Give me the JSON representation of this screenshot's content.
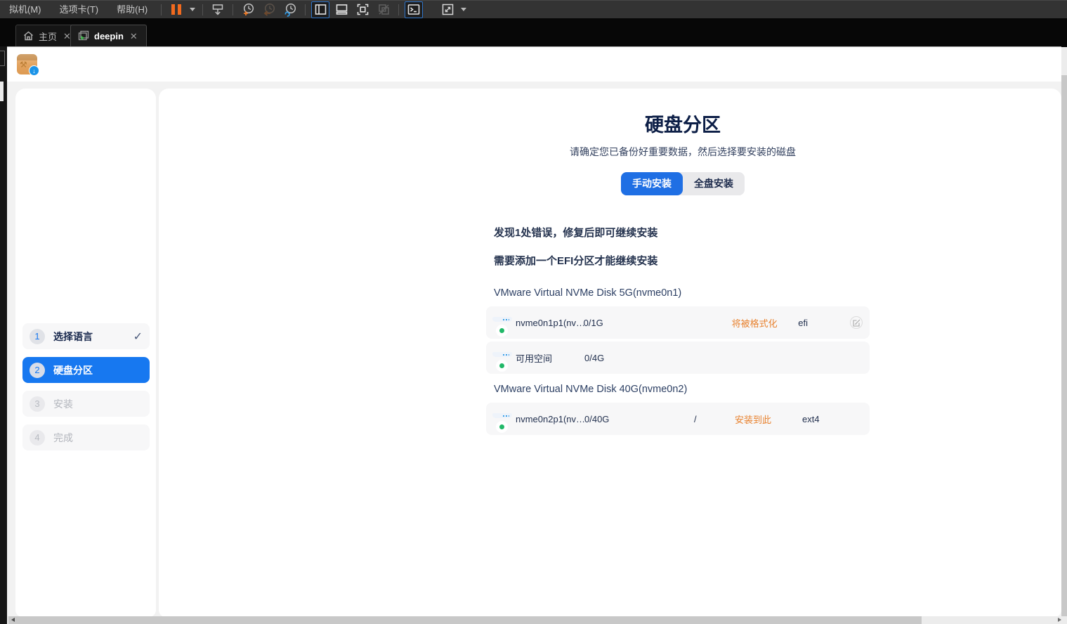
{
  "vmware": {
    "menu": {
      "vm": "拟机(M)",
      "tabs": "选项卡(T)",
      "help": "帮助(H)"
    },
    "tabs": {
      "home": "主页",
      "vm": "deepin"
    },
    "close_glyph": "✕"
  },
  "installer": {
    "steps": [
      {
        "num": "1",
        "label": "选择语言",
        "state": "done",
        "check": "✓"
      },
      {
        "num": "2",
        "label": "硬盘分区",
        "state": "active"
      },
      {
        "num": "3",
        "label": "安装",
        "state": "pending"
      },
      {
        "num": "4",
        "label": "完成",
        "state": "pending"
      }
    ],
    "title": "硬盘分区",
    "subtitle": "请确定您已备份好重要数据，然后选择要安装的磁盘",
    "modes": {
      "manual": "手动安装",
      "full": "全盘安装"
    },
    "errors": {
      "summary": "发现1处错误，修复后即可继续安装",
      "detail": "需要添加一个EFI分区才能继续安装"
    },
    "disk_groups": [
      {
        "title": "VMware Virtual NVMe Disk 5G(nvme0n1)",
        "rows": [
          {
            "name": "nvme0n1p1(nv…",
            "size": "0/1G",
            "mount": "",
            "status": "将被格式化",
            "fs": "efi"
          },
          {
            "name": "可用空间",
            "size": "0/4G",
            "mount": "",
            "status": "",
            "fs": ""
          }
        ]
      },
      {
        "title": "VMware Virtual NVMe Disk 40G(nvme0n2)",
        "rows": [
          {
            "name": "nvme0n2p1(nv…",
            "size": "0/40G",
            "mount": "/",
            "status": "安装到此",
            "fs": "ext4"
          }
        ]
      }
    ],
    "colors": {
      "accent": "#1778f0",
      "warning": "#e8822f"
    }
  }
}
